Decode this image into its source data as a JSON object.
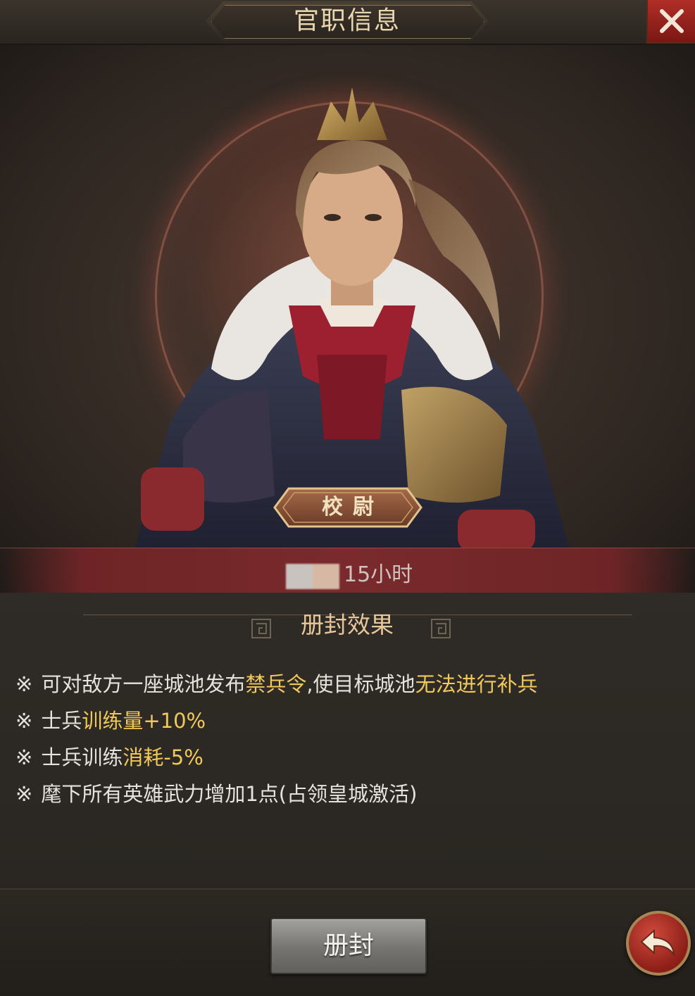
{
  "header": {
    "title": "官职信息",
    "close_icon": "close-icon"
  },
  "portrait": {
    "rank_title": "校尉",
    "duration": "15小时"
  },
  "effects": {
    "section_title": "册封效果",
    "lines": [
      {
        "prefix": "※",
        "parts": [
          {
            "text": "可对敌方一座城池发布",
            "hl": false
          },
          {
            "text": "禁兵令",
            "hl": true
          },
          {
            "text": ",使目标城池",
            "hl": false
          },
          {
            "text": "无法进行补兵",
            "hl": true
          }
        ]
      },
      {
        "prefix": "※",
        "parts": [
          {
            "text": "士兵",
            "hl": false
          },
          {
            "text": "训练量+10%",
            "hl": true
          }
        ]
      },
      {
        "prefix": "※",
        "parts": [
          {
            "text": "士兵训练",
            "hl": false
          },
          {
            "text": "消耗-5%",
            "hl": true
          }
        ]
      },
      {
        "prefix": "※",
        "parts": [
          {
            "text": "麾下所有英雄武力增加1点(占领皇城激活)",
            "hl": false
          }
        ]
      }
    ]
  },
  "footer": {
    "confirm_label": "册封",
    "back_icon": "back-arrow-icon"
  },
  "colors": {
    "highlight": "#f0c95a",
    "text": "#e6e2dc",
    "title": "#e7c79b",
    "close": "#b12e28"
  }
}
